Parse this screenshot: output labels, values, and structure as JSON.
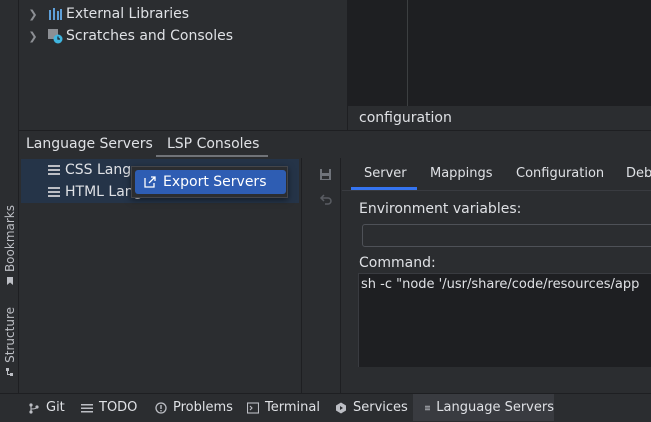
{
  "sidebar_vertical": {
    "bookmarks_label": "Bookmarks",
    "structure_label": "Structure"
  },
  "project_tree": {
    "items": [
      {
        "label": "External Libraries",
        "icon": "library-icon"
      },
      {
        "label": "Scratches and Consoles",
        "icon": "scratches-icon"
      }
    ]
  },
  "editor": {
    "config_label": "configuration"
  },
  "tool_window": {
    "tabs": [
      {
        "label": "Language Servers"
      },
      {
        "label": "LSP Consoles"
      }
    ]
  },
  "servers_list": {
    "items": [
      {
        "label": "CSS Langu"
      },
      {
        "label": "HTML Lang"
      }
    ]
  },
  "context_menu": {
    "item_label": "Export Servers"
  },
  "config_panel": {
    "tabs": [
      {
        "label": "Server"
      },
      {
        "label": "Mappings"
      },
      {
        "label": "Configuration"
      },
      {
        "label": "Deb"
      }
    ],
    "env_label": "Environment variables:",
    "env_value": "",
    "command_label": "Command:",
    "command_value": "sh -c \"node '/usr/share/code/resources/app"
  },
  "status_bar": {
    "items": [
      {
        "label": "Git",
        "icon": "git-icon"
      },
      {
        "label": "TODO",
        "icon": "todo-icon"
      },
      {
        "label": "Problems",
        "icon": "problems-icon"
      },
      {
        "label": "Terminal",
        "icon": "terminal-icon"
      },
      {
        "label": "Services",
        "icon": "services-icon"
      },
      {
        "label": "Language Servers",
        "icon": "language-servers-icon"
      }
    ]
  },
  "colors": {
    "accent": "#3574f0",
    "selection": "#2e5db3",
    "background": "#2b2d30",
    "editor_background": "#1e1f22"
  }
}
